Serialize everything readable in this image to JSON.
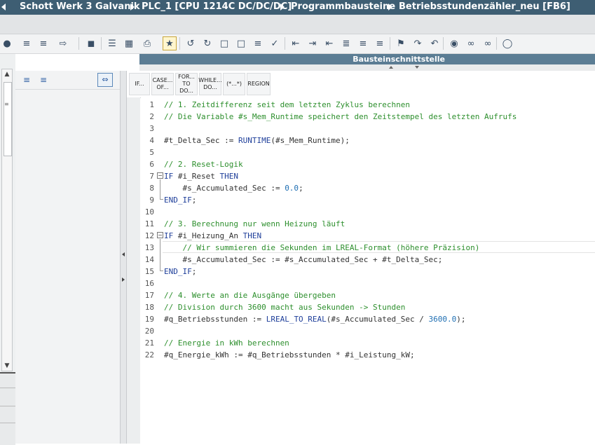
{
  "breadcrumb": [
    "Schott Werk 3 Galvanik",
    "PLC_1 [CPU 1214C DC/DC/DC]",
    "Programmbausteine",
    "Betriebsstundenzähler_neu [FB6]"
  ],
  "interface_header": "Bausteinschnittstelle",
  "keyword_buttons": [
    "IF...",
    "CASE... OF...",
    "FOR... TO DO...",
    "WHILE... DO...",
    "(*...*)",
    "REGION"
  ],
  "colors": {
    "titlebar": "#3e5e73",
    "comment": "#2d8f2d",
    "keyword": "#1f3f9a",
    "number": "#1f6fb3"
  },
  "code_lines": [
    {
      "n": "1",
      "text": "// 1. Zeitdifferenz seit dem letzten Zyklus berechnen",
      "kind": "comment"
    },
    {
      "n": "2",
      "text": "// Die Variable #s_Mem_Runtime speichert den Zeitstempel des letzten Aufrufs",
      "kind": "comment"
    },
    {
      "n": "3",
      "text": "",
      "kind": "blank"
    },
    {
      "n": "4",
      "text": "#t_Delta_Sec := RUNTIME(#s_Mem_Runtime);",
      "kind": "code"
    },
    {
      "n": "5",
      "text": "",
      "kind": "blank"
    },
    {
      "n": "6",
      "text": "// 2. Reset-Logik",
      "kind": "comment"
    },
    {
      "n": "7",
      "text": "IF #i_Reset THEN",
      "kind": "code"
    },
    {
      "n": "8",
      "text": "    #s_Accumulated_Sec := 0.0;",
      "kind": "code"
    },
    {
      "n": "9",
      "text": "END_IF;",
      "kind": "code"
    },
    {
      "n": "10",
      "text": "",
      "kind": "blank"
    },
    {
      "n": "11",
      "text": "// 3. Berechnung nur wenn Heizung läuft",
      "kind": "comment"
    },
    {
      "n": "12",
      "text": "IF #i_Heizung_An THEN",
      "kind": "code"
    },
    {
      "n": "13",
      "text": "    // Wir summieren die Sekunden im LREAL-Format (höhere Präzision)",
      "kind": "comment"
    },
    {
      "n": "14",
      "text": "    #s_Accumulated_Sec := #s_Accumulated_Sec + #t_Delta_Sec;",
      "kind": "code"
    },
    {
      "n": "15",
      "text": "END_IF;",
      "kind": "code"
    },
    {
      "n": "16",
      "text": "",
      "kind": "blank"
    },
    {
      "n": "17",
      "text": "// 4. Werte an die Ausgänge übergeben",
      "kind": "comment"
    },
    {
      "n": "18",
      "text": "// Division durch 3600 macht aus Sekunden -> Stunden",
      "kind": "comment"
    },
    {
      "n": "19",
      "text": "#q_Betriebsstunden := LREAL_TO_REAL(#s_Accumulated_Sec / 3600.0);",
      "kind": "code"
    },
    {
      "n": "20",
      "text": "",
      "kind": "blank"
    },
    {
      "n": "21",
      "text": "// Energie in kWh berechnen",
      "kind": "comment"
    },
    {
      "n": "22",
      "text": "#q_Energie_kWh := #q_Betriebsstunden * #i_Leistung_kW;",
      "kind": "code"
    }
  ]
}
